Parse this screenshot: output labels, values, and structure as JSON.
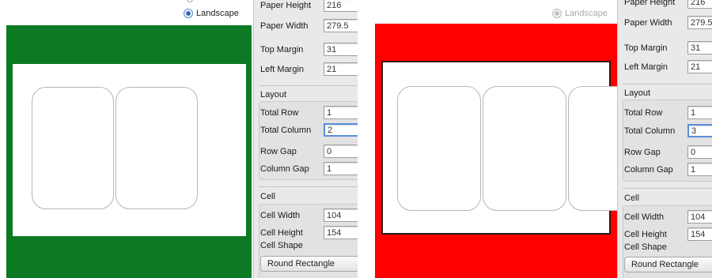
{
  "colors": {
    "left_canvas": "#0b7a22",
    "right_canvas": "#ff0000"
  },
  "left": {
    "orientation_label": "Landscape",
    "paper_height_label": "Paper Height",
    "paper_height": "216",
    "paper_width_label": "Paper Width",
    "paper_width": "279.5",
    "top_margin_label": "Top Margin",
    "top_margin": "31",
    "left_margin_label": "Left Margin",
    "left_margin": "21",
    "layout_title": "Layout",
    "total_row_label": "Total Row",
    "total_row": "1",
    "total_column_label": "Total Column",
    "total_column": "2",
    "row_gap_label": "Row Gap",
    "row_gap": "0",
    "column_gap_label": "Column Gap",
    "column_gap": "1",
    "cell_title": "Cell",
    "cell_width_label": "Cell Width",
    "cell_width": "104",
    "cell_height_label": "Cell Height",
    "cell_height": "154",
    "cell_shape_label": "Cell Shape",
    "cell_shape_value": "Round Rectangle"
  },
  "right": {
    "orientation_label": "Landscape",
    "paper_height_label": "Paper Height",
    "paper_height": "216",
    "paper_width_label": "Paper Width",
    "paper_width": "279.5",
    "top_margin_label": "Top Margin",
    "top_margin": "31",
    "left_margin_label": "Left Margin",
    "left_margin": "21",
    "layout_title": "Layout",
    "total_row_label": "Total Row",
    "total_row": "1",
    "total_column_label": "Total Column",
    "total_column": "3",
    "row_gap_label": "Row Gap",
    "row_gap": "0",
    "column_gap_label": "Column Gap",
    "column_gap": "1",
    "cell_title": "Cell",
    "cell_width_label": "Cell Width",
    "cell_width": "104",
    "cell_height_label": "Cell Height",
    "cell_height": "154",
    "cell_shape_label": "Cell Shape",
    "cell_shape_value": "Round Rectangle"
  }
}
